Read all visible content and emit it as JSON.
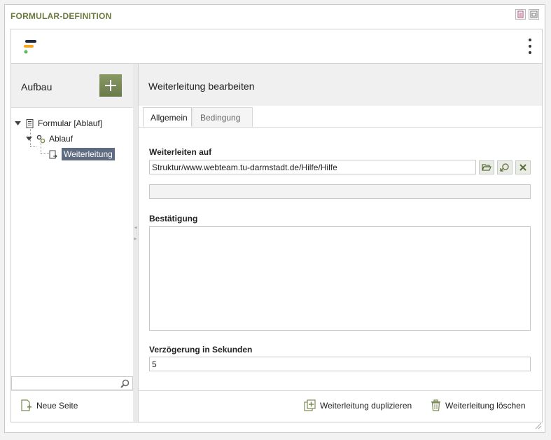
{
  "window": {
    "title": "FORMULAR-DEFINITION",
    "icons": [
      "document-icon",
      "window-icon"
    ]
  },
  "toolbar": {
    "logo": "app-logo",
    "menu_icon": "more-vertical-icon"
  },
  "left": {
    "title": "Aufbau",
    "add_icon": "plus-icon",
    "tree": [
      {
        "label": "Formular [Ablauf]",
        "icon": "form-icon",
        "expanded": true,
        "level": 0
      },
      {
        "label": "Ablauf",
        "icon": "gears-icon",
        "expanded": true,
        "level": 1
      },
      {
        "label": "Weiterleitung",
        "icon": "redirect-icon",
        "selected": true,
        "level": 2
      }
    ],
    "search_value": "",
    "new_page_label": "Neue Seite"
  },
  "right": {
    "title": "Weiterleitung bearbeiten",
    "tabs": [
      {
        "label": "Allgemein",
        "active": true
      },
      {
        "label": "Bedingung",
        "active": false
      }
    ],
    "redirect": {
      "label": "Weiterleiten auf",
      "value": "Struktur/www.webteam.tu-darmstadt.de/Hilfe/Hilfe",
      "secondary_value": ""
    },
    "confirmation": {
      "label": "Bestätigung",
      "value": ""
    },
    "delay": {
      "label": "Verzögerung in Sekunden",
      "value": "5"
    },
    "duplicate_label": "Weiterleitung duplizieren",
    "delete_label": "Weiterleitung löschen"
  },
  "colors": {
    "title_green": "#6b7a3e",
    "accent_green": "#7b8b55",
    "selection": "#5f6b80",
    "logo_navy": "#1f2a4a",
    "logo_orange": "#f5a623",
    "logo_green": "#5cb85c"
  }
}
